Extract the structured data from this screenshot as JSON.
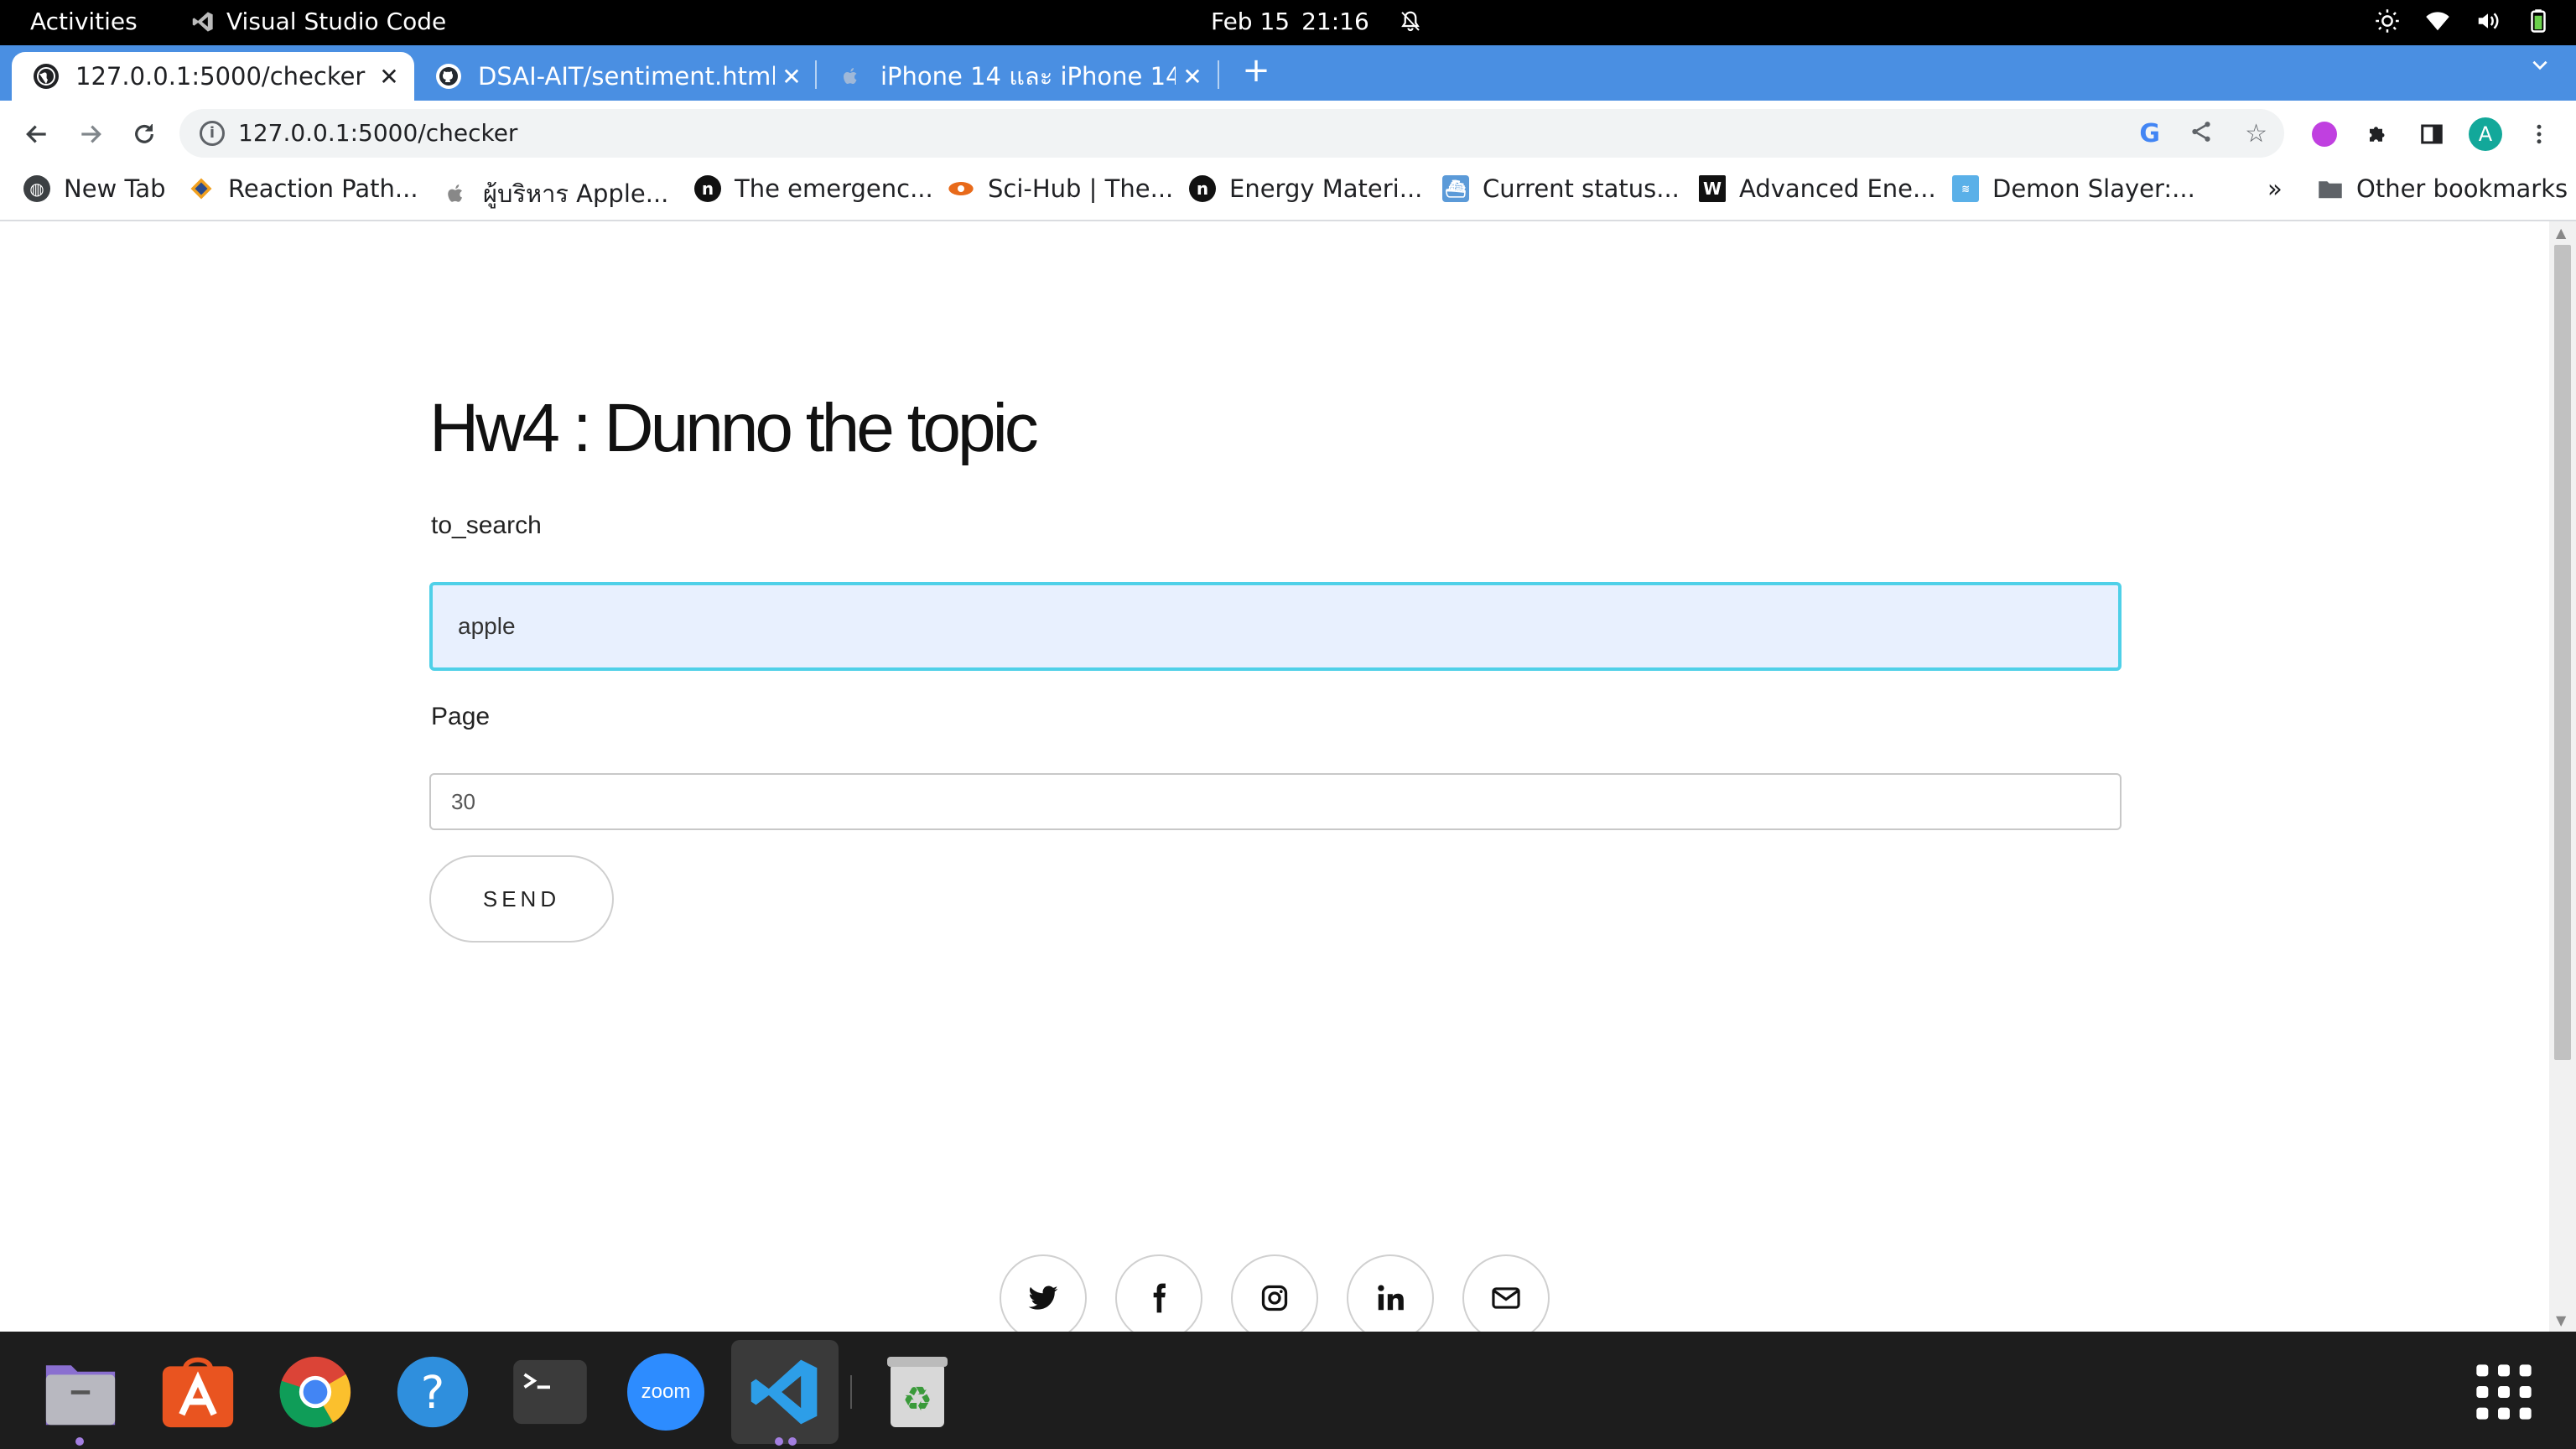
{
  "topbar": {
    "activities": "Activities",
    "app_name": "Visual Studio Code",
    "date": "Feb 15",
    "time": "21:16"
  },
  "tabs": [
    {
      "title": "127.0.0.1:5000/checker",
      "active": true
    },
    {
      "title": "DSAI-AIT/sentiment.html",
      "active": false
    },
    {
      "title": "iPhone 14 และ iPhone 14",
      "active": false
    }
  ],
  "omnibox": {
    "url": "127.0.0.1:5000/checker",
    "profile_initial": "A"
  },
  "bookmarks": [
    {
      "label": "New Tab"
    },
    {
      "label": "Reaction Path..."
    },
    {
      "label": "ผู้บริหาร Apple..."
    },
    {
      "label": "The emergenc..."
    },
    {
      "label": "Sci-Hub | The..."
    },
    {
      "label": "Energy Materi..."
    },
    {
      "label": "Current status..."
    },
    {
      "label": "Advanced Ene..."
    },
    {
      "label": "Demon Slayer:..."
    }
  ],
  "bookmarks_more": "»",
  "other_bookmarks": "Other bookmarks",
  "page": {
    "title": "Hw4 : Dunno the topic",
    "search_label": "to_search",
    "search_value": "apple",
    "page_label": "Page",
    "page_value": "30",
    "send_label": "SEND"
  },
  "social_icons": [
    "twitter-icon",
    "facebook-icon",
    "instagram-icon",
    "linkedin-icon",
    "email-icon"
  ],
  "dock_apps": [
    "files",
    "app-center",
    "chrome",
    "help",
    "terminal",
    "zoom",
    "vscode",
    "trash"
  ],
  "dock_zoom_label": "zoom",
  "colors": {
    "tabstrip": "#4a8fe2",
    "input_focus_border": "#4fd0e8",
    "input_autofill_bg": "#e8f0fe",
    "dock_bg": "#1d1d1d"
  }
}
